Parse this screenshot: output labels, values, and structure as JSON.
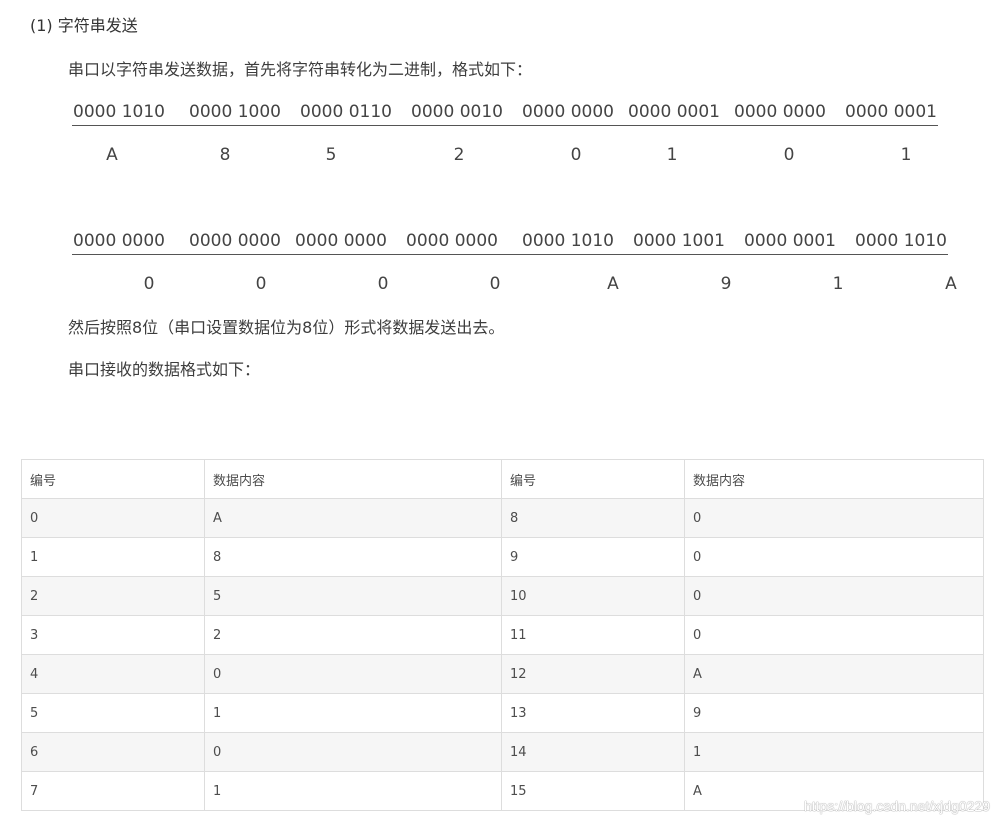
{
  "heading": "(1) 字符串发送",
  "intro": "串口以字符串发送数据，首先将字符串转化为二进制，格式如下：",
  "row1": {
    "binary": [
      "0000 1010",
      "0000 1000",
      "0000 0110",
      "0000 0010",
      "0000 0000",
      "0000 0001",
      "0000 0000",
      "0000 0001"
    ],
    "hex": [
      "A",
      "8",
      "5",
      "2",
      "0",
      "1",
      "0",
      "1"
    ]
  },
  "row2": {
    "binary": [
      "0000 0000",
      "0000 0000",
      "0000 0000",
      "0000 0000",
      "0000 1010",
      "0000 1001",
      "0000 0001",
      "0000 1010"
    ],
    "hex": [
      "0",
      "0",
      "0",
      "0",
      "A",
      "9",
      "1",
      "A"
    ]
  },
  "send_note": "然后按照8位（串口设置数据位为8位）形式将数据发送出去。",
  "receive_note": "串口接收的数据格式如下：",
  "table": {
    "headers": [
      "编号",
      "数据内容",
      "编号",
      "数据内容"
    ],
    "rows": [
      [
        "0",
        "A",
        "8",
        "0"
      ],
      [
        "1",
        "8",
        "9",
        "0"
      ],
      [
        "2",
        "5",
        "10",
        "0"
      ],
      [
        "3",
        "2",
        "11",
        "0"
      ],
      [
        "4",
        "0",
        "12",
        "A"
      ],
      [
        "5",
        "1",
        "13",
        "9"
      ],
      [
        "6",
        "0",
        "14",
        "1"
      ],
      [
        "7",
        "1",
        "15",
        "A"
      ]
    ]
  },
  "watermark": "https://blog.csdn.net/xjdg0229"
}
